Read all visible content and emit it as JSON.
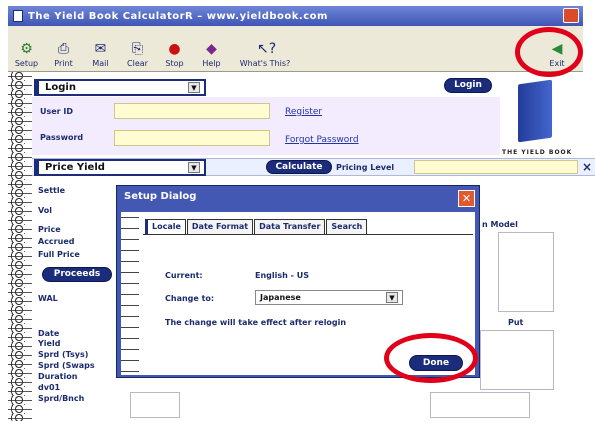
{
  "window": {
    "title": "The Yield Book CalculatorR – www.yieldbook.com"
  },
  "toolbar": {
    "items": [
      {
        "label": "Setup",
        "icon": "setup-icon"
      },
      {
        "label": "Print",
        "icon": "printer-icon"
      },
      {
        "label": "Mail",
        "icon": "mail-icon"
      },
      {
        "label": "Clear",
        "icon": "clear-icon"
      },
      {
        "label": "Stop",
        "icon": "stop-icon"
      },
      {
        "label": "Help",
        "icon": "help-icon"
      },
      {
        "label": "What's This?",
        "icon": "whats-this-icon"
      }
    ],
    "exit": {
      "label": "Exit",
      "icon": "exit-arrow-icon"
    }
  },
  "login": {
    "tab": "Login",
    "button": "Login",
    "user_id_label": "User ID",
    "password_label": "Password",
    "register_link": "Register",
    "forgot_link": "Forgot Password"
  },
  "logo": {
    "text": "THE YIELD BOOK"
  },
  "price": {
    "tab": "Price Yield",
    "calculate_button": "Calculate",
    "pricing_level_label": "Pricing Level",
    "close_glyph": "×"
  },
  "background_labels": {
    "settle": "Settle",
    "vol": "Vol",
    "price": "Price",
    "accrued": "Accrued",
    "full_price": "Full Price",
    "proceeds": "Proceeds",
    "wal": "WAL",
    "date": "Date",
    "yield": "Yield",
    "sprd_tsys": "Sprd (Tsys)",
    "sprd_swaps": "Sprd (Swaps",
    "duration": "Duration",
    "dv01": "dv01",
    "sprd_bench": "Sprd/Bnch",
    "model": "n Model",
    "put": "Put"
  },
  "dialog": {
    "title": "Setup Dialog",
    "tabs": [
      "Locale",
      "Date Format",
      "Data Transfer",
      "Search"
    ],
    "current_label": "Current:",
    "current_value": "English - US",
    "change_to_label": "Change to:",
    "change_to_value": "Japanese",
    "note": "The change will take effect after relogin",
    "done_button": "Done"
  },
  "colors": {
    "accent": "#1b2c7a",
    "dialog_frame": "#4358b2",
    "field": "#fffcd2",
    "highlight": "#e0001a"
  }
}
